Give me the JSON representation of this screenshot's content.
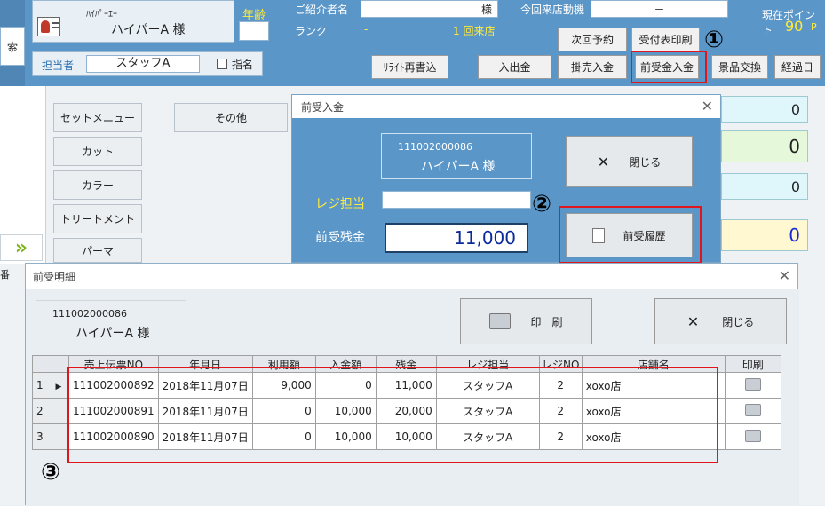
{
  "header": {
    "customer_kana": "ﾊｲﾊﾟｰｴｰ",
    "customer_name": "ハイパーA 様",
    "age_label": "年齢",
    "staff_label": "担当者",
    "staff_value": "スタッフA",
    "nominate_label": "指名",
    "referrer_label": "ご紹介者名",
    "referrer_suffix": "様",
    "rank_label": "ランク",
    "rank_value": "-",
    "visit_count": "1 回来店",
    "visit_motive_label": "今回来店動機",
    "visit_motive_value": "－",
    "points_label": "現在ポイント",
    "points_value": "90",
    "points_unit": "P",
    "left_search_label": "索",
    "buttons": {
      "next_reservation": "次回予約",
      "reception_print": "受付表印刷",
      "rewrite": "ﾘﾗｲﾄ再書込",
      "cash_in_out": "入出金",
      "credit_payment": "掛売入金",
      "prepaid_payment": "前受金入金",
      "gift_exchange": "景品交換",
      "past_days": "経過日"
    },
    "annotation_1": "①"
  },
  "menu": {
    "set_menu": "セットメニュー",
    "other": "その他",
    "cut": "カット",
    "color": "カラー",
    "treatment": "トリートメント",
    "perm": "パーマ",
    "arrow": "»",
    "side_label": "番"
  },
  "right_values": {
    "v1": "0",
    "v2": "0",
    "v3": "0",
    "v4": "0"
  },
  "prepaid_dialog": {
    "title": "前受入金",
    "card_number": "111002000086",
    "card_name": "ハイパーA 様",
    "close_label": "閉じる",
    "register_staff_label": "レジ担当",
    "balance_label": "前受残金",
    "balance_value": "11,000",
    "history_label": "前受履歴",
    "annotation_2": "②"
  },
  "detail_dialog": {
    "title": "前受明細",
    "card_number": "111002000086",
    "card_name": "ハイパーA 様",
    "print_label": "印　刷",
    "close_label": "閉じる",
    "annotation_3": "③",
    "columns": [
      "売上伝票NO",
      "年月日",
      "利用額",
      "入金額",
      "残金",
      "レジ担当",
      "レジNO",
      "店舗名",
      "印刷"
    ],
    "rows": [
      {
        "idx": "1",
        "slip": "111002000892",
        "date": "2018年11月07日",
        "used": "9,000",
        "deposit": "0",
        "balance": "11,000",
        "staff": "スタッフA",
        "reg": "2",
        "store": "xoxo店"
      },
      {
        "idx": "2",
        "slip": "111002000891",
        "date": "2018年11月07日",
        "used": "0",
        "deposit": "10,000",
        "balance": "20,000",
        "staff": "スタッフA",
        "reg": "2",
        "store": "xoxo店"
      },
      {
        "idx": "3",
        "slip": "111002000890",
        "date": "2018年11月07日",
        "used": "0",
        "deposit": "10,000",
        "balance": "10,000",
        "staff": "スタッフA",
        "reg": "2",
        "store": "xoxo店"
      }
    ]
  }
}
